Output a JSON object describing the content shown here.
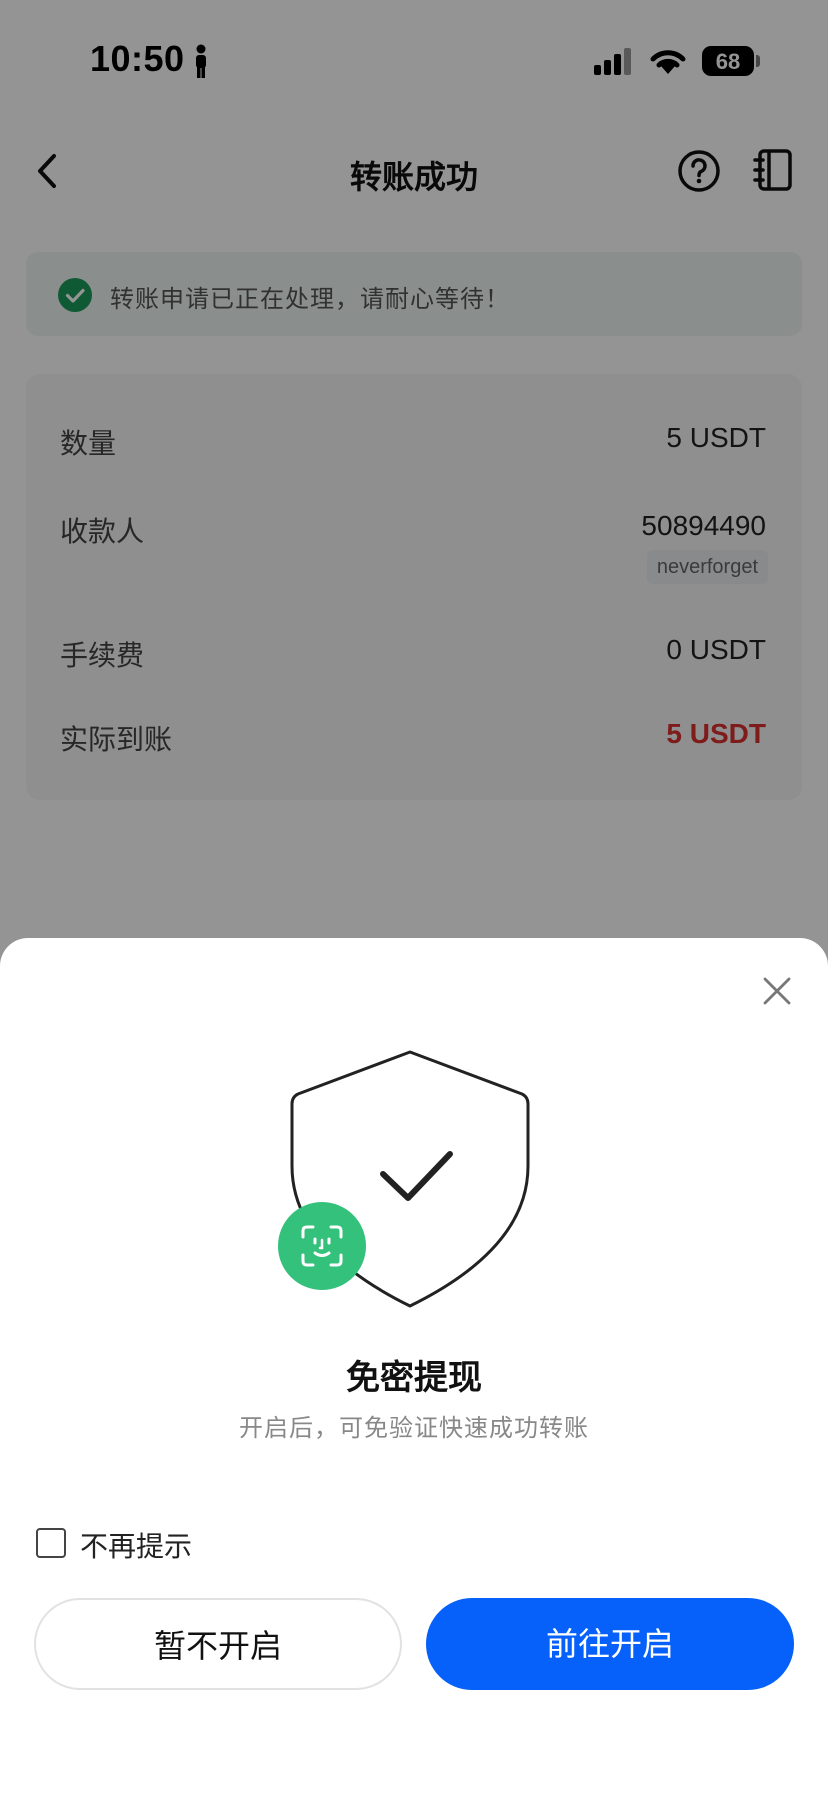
{
  "status_bar": {
    "time": "10:50",
    "battery": "68",
    "icons": [
      "person-icon",
      "signal-icon",
      "wifi-icon",
      "battery-icon"
    ]
  },
  "nav": {
    "title": "转账成功",
    "icons": [
      "back-icon",
      "help-icon",
      "book-icon"
    ]
  },
  "banner": {
    "text": "转账申请已正在处理，请耐心等待！",
    "icon": "check-circle-icon",
    "color": "#1a9a5c"
  },
  "details": {
    "rows": [
      {
        "label": "数量",
        "value": "5 USDT"
      },
      {
        "label": "收款人",
        "value": "50894490",
        "tag": "neverforget"
      },
      {
        "label": "手续费",
        "value": "0 USDT"
      },
      {
        "label": "实际到账",
        "value": "5 USDT",
        "highlight_color": "#d93030"
      }
    ]
  },
  "sheet": {
    "title": "免密提现",
    "subtitle": "开启后，可免验证快速成功转账",
    "checkbox_label": "不再提示",
    "cancel_label": "暂不开启",
    "confirm_label": "前往开启",
    "accent_color": "#0660fa",
    "badge_color": "#34c17b",
    "icons": [
      "close-icon",
      "shield-check-icon",
      "face-id-icon"
    ]
  }
}
